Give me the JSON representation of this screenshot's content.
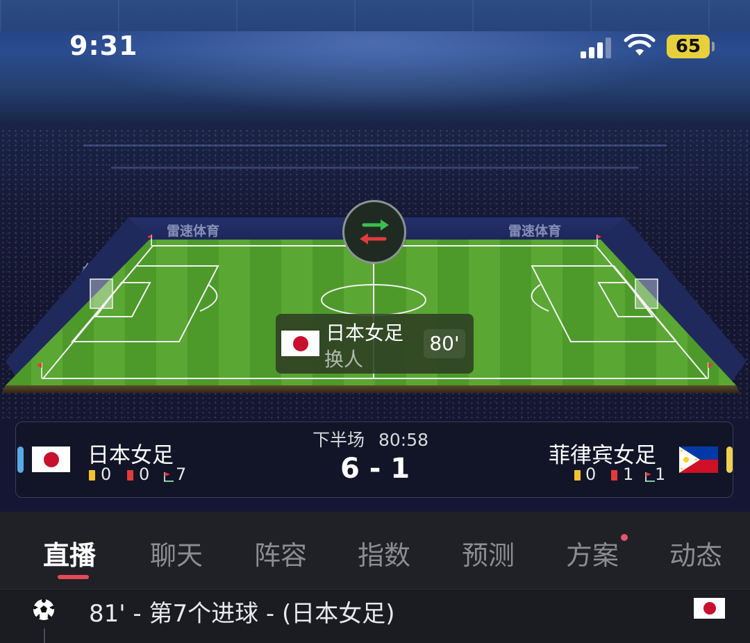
{
  "status_bar": {
    "time": "9:31",
    "battery": "65",
    "icons": [
      "signal-icon",
      "wifi-icon",
      "battery-icon"
    ]
  },
  "pitch": {
    "board_brand": "雷速体育",
    "event": {
      "team": "日本女足",
      "type": "换人",
      "minute": "80'",
      "icon": "substitution-icon"
    }
  },
  "match": {
    "period": "下半场",
    "clock": "80:58",
    "score": "6 - 1",
    "home": {
      "name": "日本女足",
      "flag": "japan-flag",
      "color": "#5aa9e6",
      "yellow_cards": "0",
      "red_cards": "0",
      "corners": "7"
    },
    "away": {
      "name": "菲律宾女足",
      "flag": "philippines-flag",
      "color": "#f0d050",
      "yellow_cards": "0",
      "red_cards": "1",
      "corners": "1"
    }
  },
  "tabs": {
    "items": [
      "直播",
      "聊天",
      "阵容",
      "指数",
      "预测",
      "方案",
      "动态"
    ],
    "active": "直播",
    "accent": "#e54a55"
  },
  "feed": {
    "items": [
      {
        "text": "81' - 第7个进球 - (日本女足)",
        "icon": "soccer-ball-icon",
        "flag": "japan-flag"
      }
    ]
  }
}
